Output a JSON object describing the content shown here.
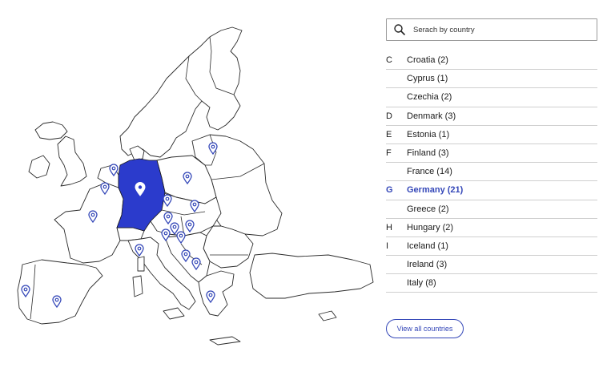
{
  "search": {
    "placeholder": "Serach by country"
  },
  "countries": [
    {
      "letter": "C",
      "label": "Croatia (2)"
    },
    {
      "letter": "",
      "label": "Cyprus (1)"
    },
    {
      "letter": "",
      "label": "Czechia (2)"
    },
    {
      "letter": "D",
      "label": "Denmark (3)"
    },
    {
      "letter": "E",
      "label": "Estonia (1)"
    },
    {
      "letter": "F",
      "label": "Finland (3)"
    },
    {
      "letter": "",
      "label": "France (14)"
    },
    {
      "letter": "G",
      "label": "Germany (21)",
      "selected": true
    },
    {
      "letter": "",
      "label": "Greece (2)"
    },
    {
      "letter": "H",
      "label": "Hungary (2)"
    },
    {
      "letter": "I",
      "label": "Iceland (1)"
    },
    {
      "letter": "",
      "label": "Ireland (3)"
    },
    {
      "letter": "",
      "label": "Italy (8)"
    }
  ],
  "view_all_label": "View all countries",
  "colors": {
    "accent": "#3447b8",
    "selected_country_fill": "#2b3bcc",
    "divider": "#cfcfcf"
  },
  "map": {
    "selected_country": "Germany"
  }
}
